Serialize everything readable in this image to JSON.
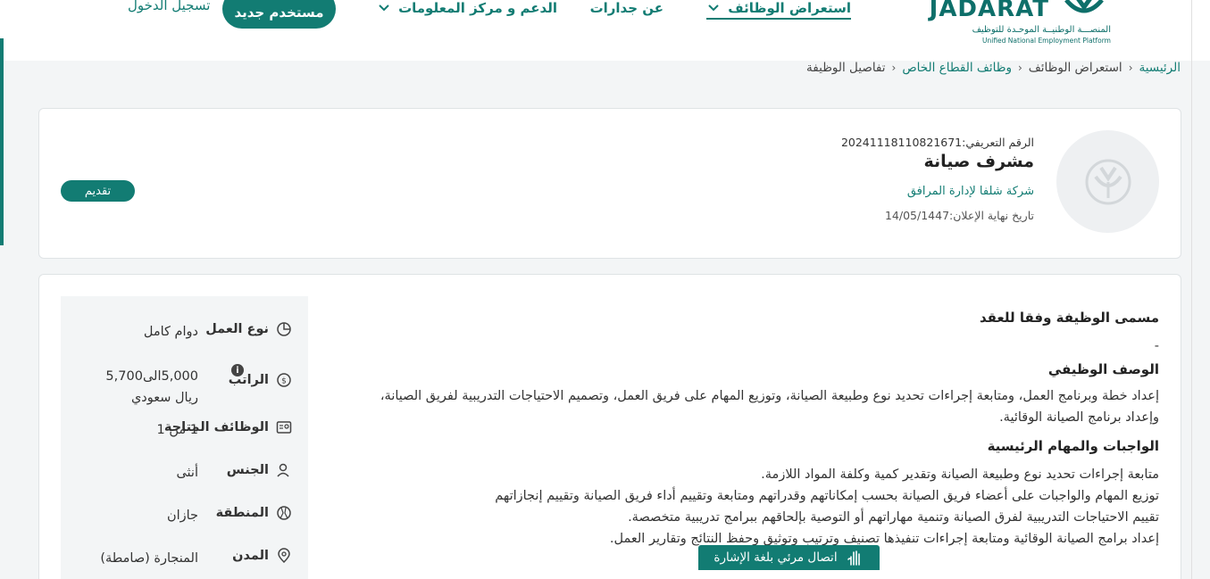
{
  "header": {
    "logo_word": "JADARAT",
    "logo_ar": "المنصـــة الوطنيــة الموحـدة للتوظيف",
    "logo_en": "Unified National Employment Platform",
    "nav": {
      "browse_jobs": "استعراض الوظائف",
      "about": "عن جدارات",
      "support": "الدعم و مركز المعلومات"
    },
    "new_user": "مستخدم جديد",
    "login": "تسجيل الدخول"
  },
  "breadcrumb": {
    "home": "الرئيسية",
    "browse": "استعراض الوظائف",
    "private_jobs": "وظائف القطاع الخاص",
    "details": "تفاصيل الوظيفة"
  },
  "job": {
    "ref_label": "الرقم التعريفي:",
    "ref_value": "20241118110821671",
    "title": "مشرف صيانة",
    "company": "شركة شلفا لإدارة المرافق",
    "deadline_label": "تاريخ نهاية الإعلان:",
    "deadline_value": "14/05/1447",
    "apply": "تقديم"
  },
  "details": {
    "work_type": {
      "label": "نوع العمل",
      "value": "دوام كامل",
      "icon": "clock-icon"
    },
    "salary": {
      "label": "الراتب",
      "value": "5,000الى5,700 ريال سعودي",
      "icon": "money-icon"
    },
    "vacancies": {
      "label": "الوظائف المتاحة",
      "value": "1 من 1",
      "icon": "id-card-icon"
    },
    "gender": {
      "label": "الجنس",
      "value": "أنثى",
      "icon": "person-icon"
    },
    "region": {
      "label": "المنطقة",
      "value": "جازان",
      "icon": "map-icon"
    },
    "city": {
      "label": "المدن",
      "value": "المنجارة (صامطة)",
      "icon": "location-pin-icon"
    }
  },
  "content": {
    "contract_title_heading": "مسمى الوظيفة وفقا للعقد",
    "contract_title_value": "-",
    "description_heading": "الوصف الوظيفي",
    "description": "إعداد خطة وبرنامج العمل، ومتابعة إجراءات تحديد نوع وطبيعة الصيانة، وتوزيع المهام على فريق العمل، وتصميم الاحتياجات التدريبية لفريق الصيانة، وإعداد برنامج الصيانة الوقائية.",
    "duties_heading": "الواجبات والمهام الرئيسية",
    "duties": [
      "متابعة إجراءات تحديد نوع وطبيعة الصيانة وتقدير كمية وكلفة المواد اللازمة.",
      "توزيع المهام والواجبات على أعضاء فريق الصيانة بحسب إمكاناتهم وقدراتهم ومتابعة وتقييم أداء فريق الصيانة وتقييم إنجازاتهم",
      "تقييم الاحتياجات التدريبية لفرق الصيانة وتنمية مهاراتهم أو التوصية بإلحاقهم ببرامج تدريبية متخصصة.",
      "إعداد برامج الصيانة الوقائية ومتابعة إجراءات تنفيذها تصنيف وترتيب وتوثيق وحفظ النتائج وتقارير العمل."
    ]
  },
  "sign_language": "اتصال مرئي بلغة الإشارة",
  "colors": {
    "primary": "#127c73",
    "background": "#f3f5f6"
  }
}
